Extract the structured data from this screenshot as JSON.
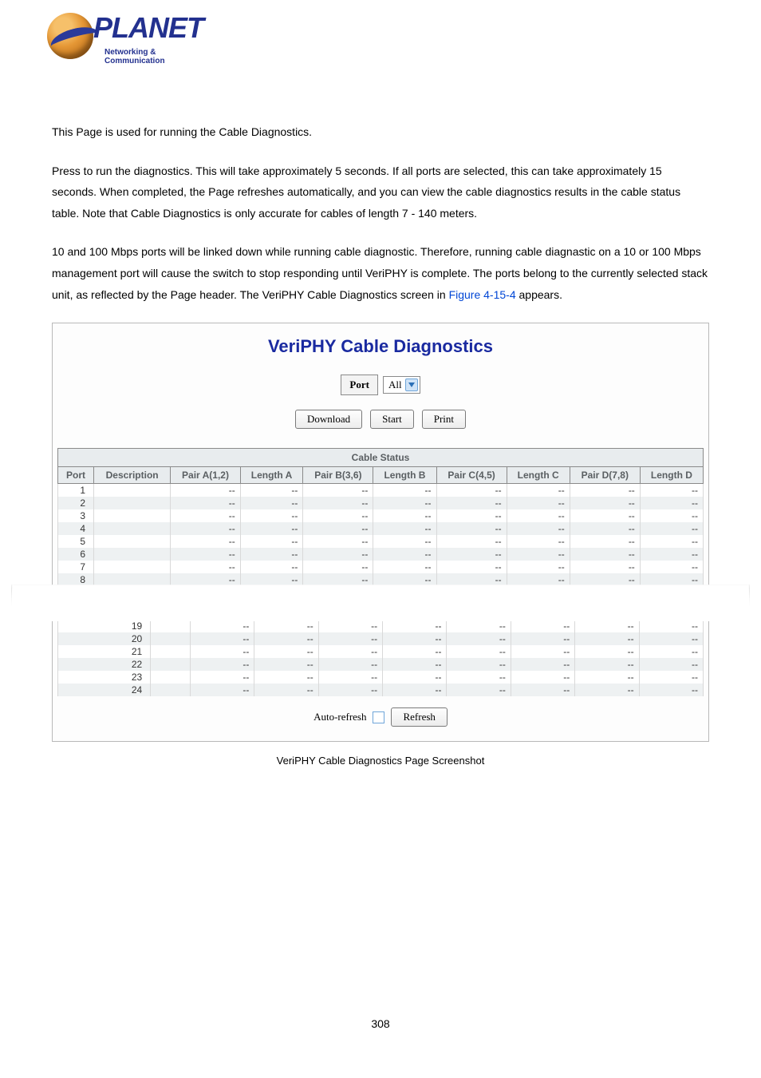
{
  "logo": {
    "brand": "PLANET",
    "tagline": "Networking & Communication"
  },
  "intro": {
    "p1": "This Page is used for running the Cable Diagnostics.",
    "p2": "Press to run the diagnostics. This will take approximately 5 seconds. If all ports are selected, this can take approximately 15 seconds. When completed, the Page refreshes automatically, and you can view the cable diagnostics results in the cable status table. Note that Cable Diagnostics is only accurate for cables of length 7 - 140 meters.",
    "p3a": "10 and 100 Mbps ports will be linked down while running cable diagnostic. Therefore, running cable diagnastic on a 10 or 100 Mbps management port will cause the switch to stop responding until VeriPHY is complete. The ports belong to the currently selected stack unit, as reflected by the Page header. The VeriPHY Cable Diagnostics screen in ",
    "fig_link": "Figure 4-15-4",
    "p3b": " appears."
  },
  "panel": {
    "title": "VeriPHY Cable Diagnostics",
    "port_label": "Port",
    "port_select_value": "All",
    "buttons": {
      "download": "Download",
      "start": "Start",
      "print": "Print"
    },
    "table": {
      "section": "Cable Status",
      "headers": [
        "Port",
        "Description",
        "Pair A(1,2)",
        "Length A",
        "Pair B(3,6)",
        "Length B",
        "Pair C(4,5)",
        "Length C",
        "Pair D(7,8)",
        "Length D"
      ],
      "rows_top": [
        {
          "port": "1"
        },
        {
          "port": "2"
        },
        {
          "port": "3"
        },
        {
          "port": "4"
        },
        {
          "port": "5"
        },
        {
          "port": "6"
        },
        {
          "port": "7"
        },
        {
          "port": "8"
        }
      ],
      "rows_bottom": [
        {
          "port": "19"
        },
        {
          "port": "20"
        },
        {
          "port": "21"
        },
        {
          "port": "22"
        },
        {
          "port": "23"
        },
        {
          "port": "24"
        }
      ],
      "dash": "--"
    },
    "footer": {
      "autorefresh_label": "Auto-refresh",
      "refresh": "Refresh"
    }
  },
  "caption": "VeriPHY Cable Diagnostics Page Screenshot",
  "page_number": "308"
}
